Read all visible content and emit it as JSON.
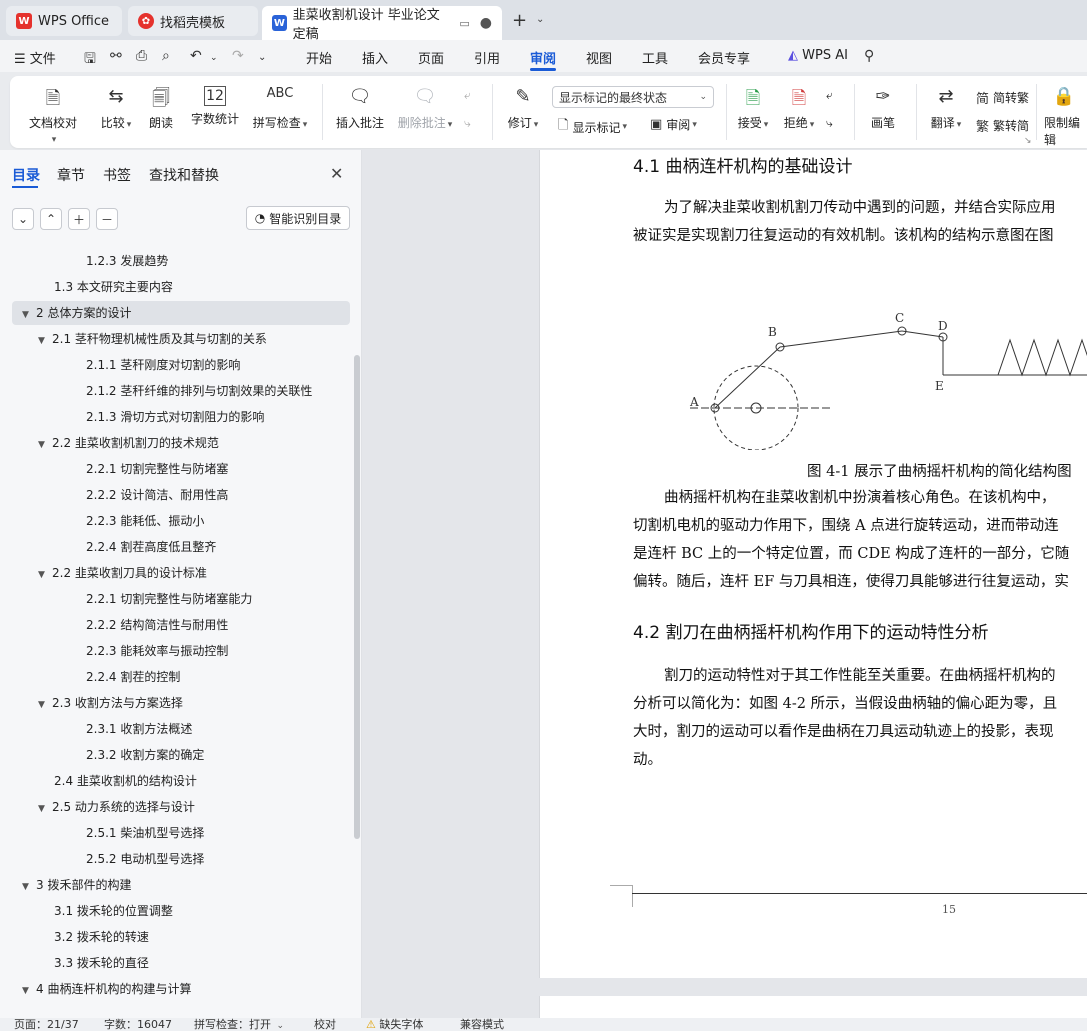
{
  "tabs": [
    {
      "label": "WPS Office"
    },
    {
      "label": "找稻壳模板"
    },
    {
      "label": "韭菜收割机设计 毕业论文定稿"
    }
  ],
  "menu": {
    "file": "文件",
    "items": [
      "开始",
      "插入",
      "页面",
      "引用",
      "审阅",
      "视图",
      "工具",
      "会员专享"
    ],
    "ai": "WPS AI"
  },
  "ribbon": {
    "doc_check": "文档校对",
    "compare": "比较",
    "read_aloud": "朗读",
    "word_count": "字数统计",
    "spell_check": "拼写检查",
    "insert_comment": "插入批注",
    "delete_comment": "删除批注",
    "revise": "修订",
    "markup_mode": "显示标记的最终状态",
    "show_markup": "显示标记",
    "review": "审阅",
    "accept": "接受",
    "reject": "拒绝",
    "pen": "画笔",
    "translate": "翻译",
    "to_traditional": "简转繁",
    "to_simplified": "繁转简",
    "restrict_edit": "限制编辑",
    "spell_icon_text": "ABC",
    "word_count_icon_text": "12"
  },
  "panel": {
    "tabs": [
      "目录",
      "章节",
      "书签",
      "查找和替换"
    ],
    "smart_toc": "智能识别目录",
    "toc": [
      {
        "label": "1.2.3  发展趋势",
        "level": 3,
        "expand": false
      },
      {
        "label": "1.3  本文研究主要内容",
        "level": 2,
        "expand": false
      },
      {
        "label": "2 总体方案的设计",
        "level": 1,
        "expand": true,
        "selected": true
      },
      {
        "label": "2.1 茎秆物理机械性质及其与切割的关系",
        "level": 2,
        "expand": true
      },
      {
        "label": "2.1.1 茎秆刚度对切割的影响",
        "level": 3,
        "expand": false
      },
      {
        "label": "2.1.2  茎秆纤维的排列与切割效果的关联性",
        "level": 3,
        "expand": false
      },
      {
        "label": "2.1.3  滑切方式对切割阻力的影响",
        "level": 3,
        "expand": false
      },
      {
        "label": "2.2  韭菜收割机割刀的技术规范",
        "level": 2,
        "expand": true
      },
      {
        "label": "2.2.1  切割完整性与防堵塞",
        "level": 3,
        "expand": false
      },
      {
        "label": "2.2.2  设计简洁、耐用性高",
        "level": 3,
        "expand": false
      },
      {
        "label": "2.2.3  能耗低、振动小",
        "level": 3,
        "expand": false
      },
      {
        "label": "2.2.4  割茬高度低且整齐",
        "level": 3,
        "expand": false
      },
      {
        "label": "2.2  韭菜收割刀具的设计标准",
        "level": 2,
        "expand": true
      },
      {
        "label": "2.2.1  切割完整性与防堵塞能力",
        "level": 3,
        "expand": false
      },
      {
        "label": "2.2.2  结构简洁性与耐用性",
        "level": 3,
        "expand": false
      },
      {
        "label": "2.2.3  能耗效率与振动控制",
        "level": 3,
        "expand": false
      },
      {
        "label": "2.2.4  割茬的控制",
        "level": 3,
        "expand": false
      },
      {
        "label": "2.3  收割方法与方案选择",
        "level": 2,
        "expand": true
      },
      {
        "label": "2.3.1  收割方法概述",
        "level": 3,
        "expand": false
      },
      {
        "label": "2.3.2  收割方案的确定",
        "level": 3,
        "expand": false
      },
      {
        "label": "2.4  韭菜收割机的结构设计",
        "level": 2,
        "expand": false
      },
      {
        "label": "2.5  动力系统的选择与设计",
        "level": 2,
        "expand": true
      },
      {
        "label": "2.5.1  柴油机型号选择",
        "level": 3,
        "expand": false
      },
      {
        "label": "2.5.2  电动机型号选择",
        "level": 3,
        "expand": false
      },
      {
        "label": "3  拨禾部件的构建",
        "level": 1,
        "expand": true
      },
      {
        "label": "3.1 拨禾轮的位置调整",
        "level": 2,
        "expand": false
      },
      {
        "label": "3.2 拨禾轮的转速",
        "level": 2,
        "expand": false
      },
      {
        "label": "3.3  拨禾轮的直径",
        "level": 2,
        "expand": false
      },
      {
        "label": "4  曲柄连杆机构的构建与计算",
        "level": 1,
        "expand": true
      }
    ]
  },
  "document": {
    "heading1": "4.1  曲柄连杆机构的基础设计",
    "para1": [
      "为了解决韭菜收割机割刀传动中遇到的问题，并结合实际应用",
      "被证实是实现割刀往复运动的有效机制。该机构的结构示意图在图"
    ],
    "figure_labels": {
      "a": "A",
      "b": "B",
      "c": "C",
      "d": "D",
      "e": "E"
    },
    "caption": "图 4-1  展示了曲柄摇杆机构的简化结构图",
    "para2": [
      "曲柄摇杆机构在韭菜收割机中扮演着核心角色。在该机构中，",
      "切割机电机的驱动力作用下，围绕 A 点进行旋转运动，进而带动连",
      "是连杆 BC 上的一个特定位置，而 CDE 构成了连杆的一部分，它随",
      "偏转。随后，连杆 EF 与刀具相连，使得刀具能够进行往复运动，实"
    ],
    "heading2": "4.2  割刀在曲柄摇杆机构作用下的运动特性分析",
    "para3": [
      "割刀的运动特性对于其工作性能至关重要。在曲柄摇杆机构的",
      "分析可以简化为：如图 4-2 所示，当假设曲柄轴的偏心距为零，且",
      "大时，割刀的运动可以看作是曲柄在刀具运动轨迹上的投影，表现",
      "动。"
    ],
    "page_number": "15"
  },
  "status": {
    "page": "页面：21/37",
    "words": "字数：16047",
    "spell": "拼写检查：打开",
    "proof": "校对",
    "missing_font": "缺失字体",
    "compat": "兼容模式"
  },
  "colors": {
    "accent": "#1a5bd6",
    "wps_red": "#e5322d"
  }
}
